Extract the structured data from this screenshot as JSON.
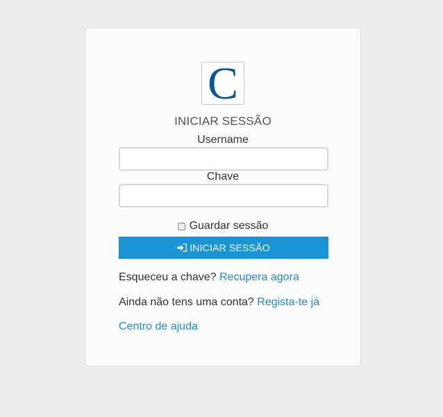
{
  "logo": {
    "letter": "C"
  },
  "title": "INICIAR SESSÃO",
  "form": {
    "username_label": "Username",
    "username_value": "",
    "password_label": "Chave",
    "password_value": "",
    "remember_label": "Guardar sessão",
    "submit_label": "INICIAR SESSÃO"
  },
  "links": {
    "forgot_text": "Esqueceu a chave?",
    "forgot_link": "Recupera agora",
    "register_text": "Ainda não tens uma conta?",
    "register_link": "Regista-te já",
    "help_link": "Centro de ajuda"
  },
  "colors": {
    "accent": "#1995d6",
    "link": "#1f8ccc",
    "logo": "#0b5694",
    "background": "#ececec",
    "card": "#fcfcfc"
  },
  "icons": {
    "submit": "sign-in-icon"
  }
}
